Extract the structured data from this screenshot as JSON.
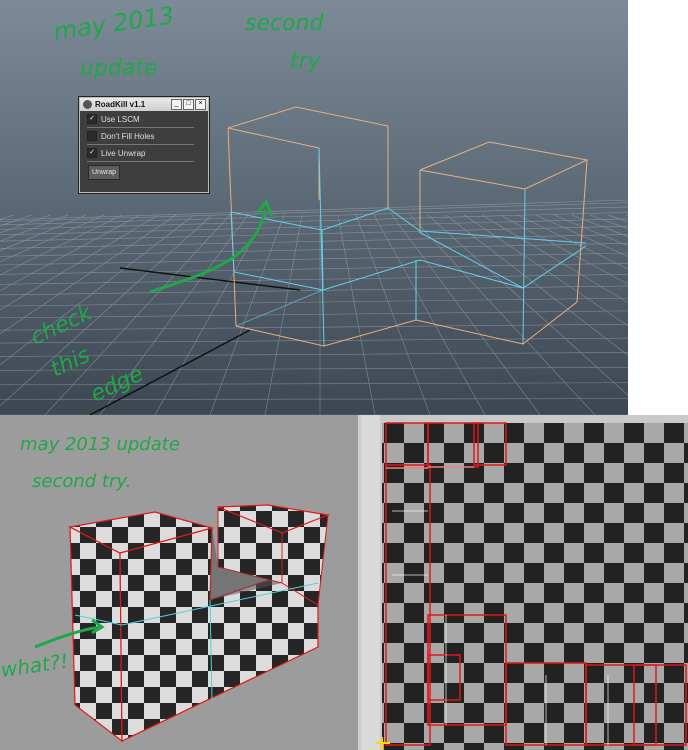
{
  "top_viewport": {
    "notes": {
      "line1": "may 2013",
      "line2": "update",
      "line3": "second",
      "line4": "try",
      "edge_note": [
        "check",
        "this",
        "edge"
      ]
    }
  },
  "roadkill_window": {
    "title": "RoadKill v1.1",
    "window_buttons": [
      "_",
      "□",
      "×"
    ],
    "options": [
      {
        "label": "Use LSCM",
        "checked": true
      },
      {
        "label": "Don't Fill Holes",
        "checked": false
      },
      {
        "label": "Live Unwrap",
        "checked": true
      }
    ],
    "unwrap_button": "Unwrap"
  },
  "bottom_left_viewport": {
    "notes": {
      "line1": "may 2013 update",
      "line2": "second   try.",
      "question": "what?!"
    }
  },
  "colors": {
    "handwriting": "#1fa84a",
    "uv_border": "#e01818",
    "wire_orange": "#e8b080",
    "wire_cyan": "#66d0e8",
    "checker_dark": "#222222",
    "checker_light": "#a8a8a8"
  }
}
